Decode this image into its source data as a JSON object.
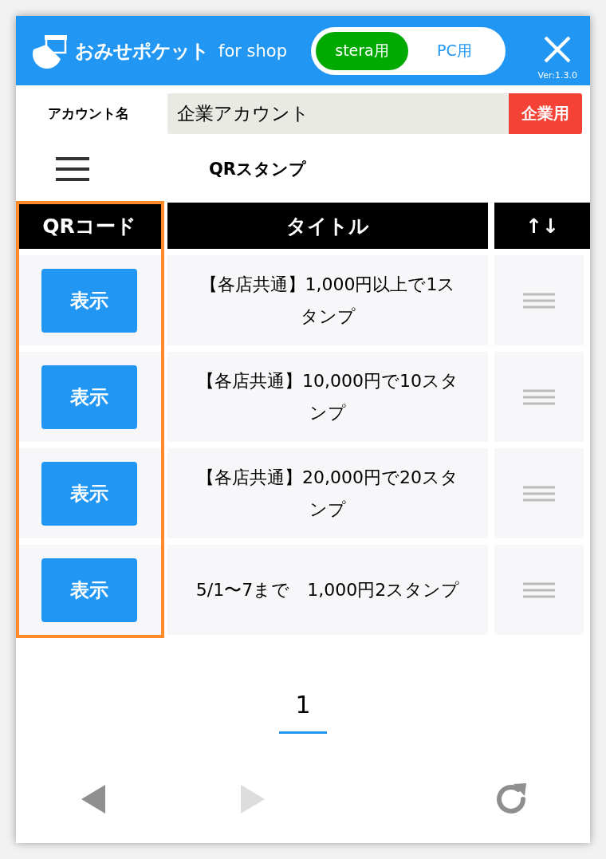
{
  "header": {
    "logo_text": "おみせポケット",
    "logo_suffix": "for shop",
    "modes": [
      {
        "label": "stera用",
        "selected": true
      },
      {
        "label": "PC用",
        "selected": false
      }
    ],
    "version": "Ver:1.3.0"
  },
  "account": {
    "label": "アカウント名",
    "value": "企業アカウント",
    "badge": "企業用"
  },
  "page_title": "QRスタンプ",
  "table": {
    "columns": [
      {
        "label": "QRコード",
        "highlighted": true
      },
      {
        "label": "タイトル",
        "highlighted": false
      },
      {
        "label": "↑↓",
        "highlighted": false
      }
    ],
    "rows": [
      {
        "button": "表示",
        "title": "【各店共通】1,000円以上で1スタンプ"
      },
      {
        "button": "表示",
        "title": "【各店共通】10,000円で10スタンプ"
      },
      {
        "button": "表示",
        "title": "【各店共通】20,000円で20スタンプ"
      },
      {
        "button": "表示",
        "title": "5/1〜7まで　1,000円2スタンプ"
      }
    ]
  },
  "pagination": [
    {
      "label": "1",
      "selected": true
    }
  ],
  "nav": {
    "back_disabled": false,
    "forward_disabled": true
  }
}
